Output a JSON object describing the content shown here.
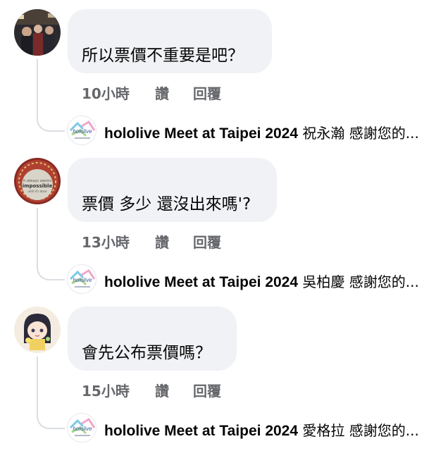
{
  "comments": [
    {
      "avatar_icon": "user-photo-avatar",
      "text": "所以票價不重要是吧？",
      "time": "10小時",
      "like_label": "讚",
      "reply_label": "回覆",
      "reply": {
        "avatar_icon": "hololive-page-avatar",
        "author": "hololive Meet at Taipei 2024",
        "preview": "祝永瀚 感謝您的..."
      }
    },
    {
      "avatar_icon": "impossible-badge-avatar",
      "text": "票價 多少 還沒出來嗎'?",
      "time": "13小時",
      "like_label": "讚",
      "reply_label": "回覆",
      "reply": {
        "avatar_icon": "hololive-page-avatar",
        "author": "hololive Meet at Taipei 2024",
        "preview": "吳柏慶 感謝您的..."
      }
    },
    {
      "avatar_icon": "anime-character-avatar",
      "text": "會先公布票價嗎？",
      "time": "15小時",
      "like_label": "讚",
      "reply_label": "回覆",
      "reply": {
        "avatar_icon": "hololive-page-avatar",
        "author": "hololive Meet at Taipei 2024",
        "preview": "愛格拉 感謝您的..."
      }
    }
  ],
  "colors": {
    "bubble_bg": "#f0f2f5",
    "meta_text": "#65676b",
    "connector": "#dadde1"
  }
}
